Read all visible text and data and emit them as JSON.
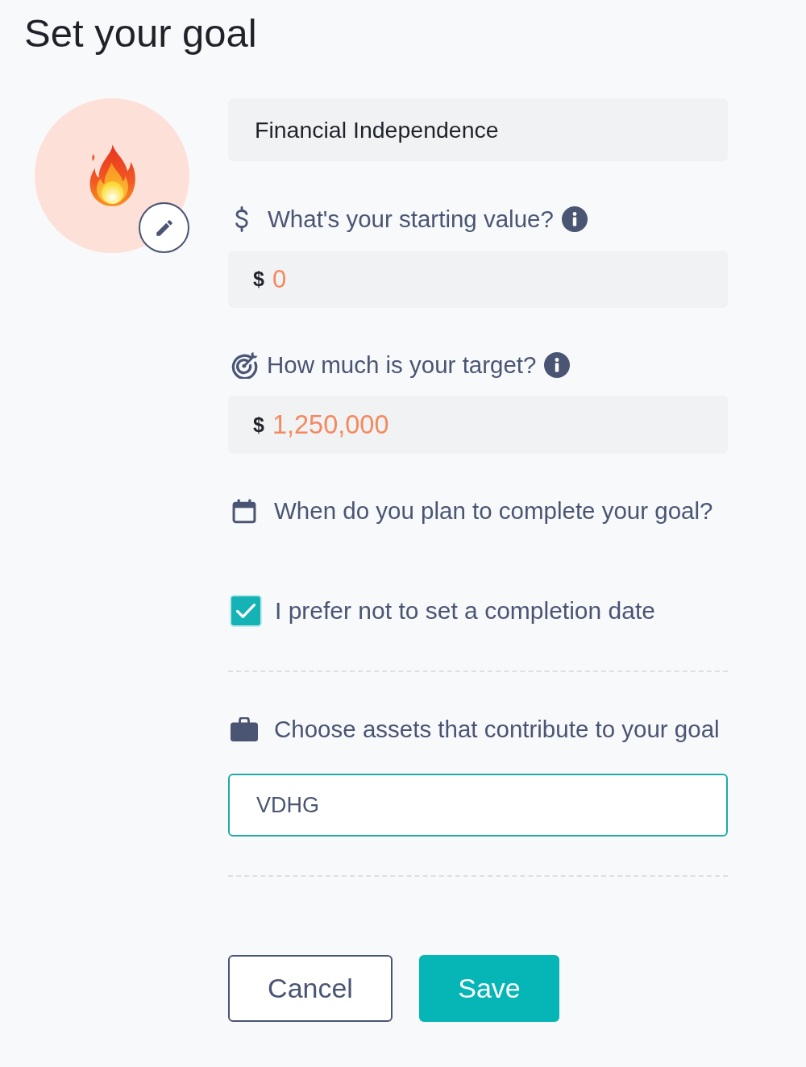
{
  "title": "Set your goal",
  "name_field": {
    "value": "Financial Independence"
  },
  "starting_value": {
    "label": "What's your starting value?",
    "currency": "$",
    "value": "0"
  },
  "target": {
    "label": "How much is your target?",
    "currency": "$",
    "value": "1,250,000"
  },
  "completion": {
    "label": "When do you plan to complete your goal?",
    "no_date_checkbox": {
      "label": "I prefer not to set a completion date",
      "checked": true
    }
  },
  "assets": {
    "label": "Choose assets that contribute to your goal",
    "value": "VDHG",
    "focused": true
  },
  "buttons": [
    {
      "label": "Cancel",
      "kind": "secondary"
    },
    {
      "label": "Save",
      "kind": "primary"
    }
  ]
}
